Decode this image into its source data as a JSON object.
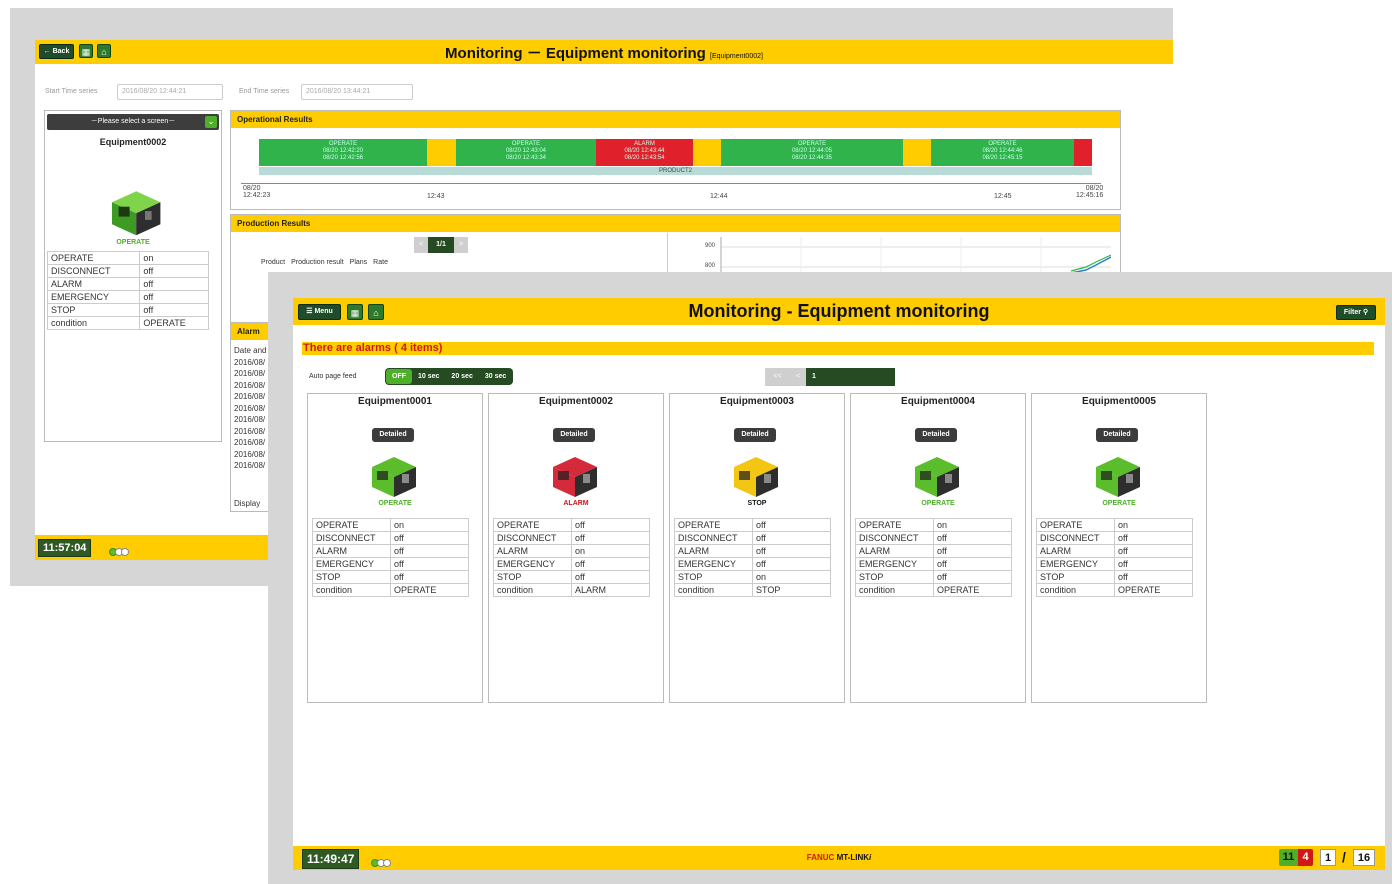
{
  "back_window": {
    "title": "Monitoring － Equipment monitoring",
    "title_tag": "[Equipment0002]",
    "back_label": "Back",
    "start_time_label": "Start Time series",
    "start_time_value": "2016/08/20 12:44:21",
    "end_time_label": "End Time series",
    "end_time_value": "2016/08/20 13:44:21",
    "screen_select": "－Please select a screen－",
    "equipment_name": "Equipment0002",
    "state_label": "OPERATE",
    "status_rows": [
      {
        "k": "OPERATE",
        "v": "on"
      },
      {
        "k": "DISCONNECT",
        "v": "off"
      },
      {
        "k": "ALARM",
        "v": "off"
      },
      {
        "k": "EMERGENCY",
        "v": "off"
      },
      {
        "k": "STOP",
        "v": "off"
      },
      {
        "k": "condition",
        "v": "OPERATE"
      }
    ],
    "operational_results": {
      "title": "Operational Results",
      "segments": [
        {
          "state": "OPERATE",
          "l1": "08/20 12:42:20",
          "l2": "08/20 12:42:56",
          "color": "#2fb34a"
        },
        {
          "state": "",
          "l1": "",
          "l2": "",
          "color": "#ffcc00"
        },
        {
          "state": "OPERATE",
          "l1": "08/20 12:43:04",
          "l2": "08/20 12:43:34",
          "color": "#2fb34a"
        },
        {
          "state": "ALARM",
          "l1": "08/20 12:43:44",
          "l2": "08/20 12:43:54",
          "color": "#e0202a"
        },
        {
          "state": "",
          "l1": "",
          "l2": "",
          "color": "#ffcc00"
        },
        {
          "state": "OPERATE",
          "l1": "08/20 12:44:05",
          "l2": "08/20 12:44:35",
          "color": "#2fb34a"
        },
        {
          "state": "",
          "l1": "",
          "l2": "",
          "color": "#ffcc00"
        },
        {
          "state": "OPERATE",
          "l1": "08/20 12:44:46",
          "l2": "08/20 12:45:15",
          "color": "#2fb34a"
        },
        {
          "state": "",
          "l1": "",
          "l2": "",
          "color": "#e0202a"
        }
      ],
      "product_band": "PRODUCT2",
      "axis_start_date": "08/20",
      "axis_start_time": "12:42:23",
      "axis_ticks": [
        "12:43",
        "12:44",
        "12:45"
      ],
      "axis_end_date": "08/20",
      "axis_end_time": "12:45:16"
    },
    "production_results": {
      "title": "Production Results",
      "pager": "1/1",
      "headers": [
        "Product",
        "Production result",
        "Plans",
        "Rate"
      ],
      "chart_y_ticks": [
        "900",
        "800"
      ]
    },
    "alarm_panel": {
      "title": "Alarm",
      "header": "Date and",
      "rows": [
        "2016/08/",
        "2016/08/",
        "2016/08/",
        "2016/08/",
        "2016/08/",
        "2016/08/",
        "2016/08/",
        "2016/08/",
        "2016/08/",
        "2016/08/"
      ],
      "footer": "Display"
    },
    "clock": "11:57:04"
  },
  "front_window": {
    "menu_label": "Menu",
    "title": "Monitoring - Equipment monitoring",
    "filter_label": "Filter",
    "alarm_banner": "There are alarms ( 4 items)",
    "auto_page_label": "Auto page feed",
    "auto_page_options": [
      "OFF",
      "10 sec",
      "20 sec",
      "30 sec"
    ],
    "pager": {
      "first": "<<",
      "prev": "<",
      "current": "1"
    },
    "equipment": [
      {
        "name": "Equipment0001",
        "detail": "Detailed",
        "state": "OPERATE",
        "state_color": "#4fae2a",
        "machine_color": "#5bbd2b",
        "rows": [
          {
            "k": "OPERATE",
            "v": "on"
          },
          {
            "k": "DISCONNECT",
            "v": "off"
          },
          {
            "k": "ALARM",
            "v": "off"
          },
          {
            "k": "EMERGENCY",
            "v": "off"
          },
          {
            "k": "STOP",
            "v": "off"
          },
          {
            "k": "condition",
            "v": "OPERATE"
          }
        ]
      },
      {
        "name": "Equipment0002",
        "detail": "Detailed",
        "state": "ALARM",
        "state_color": "#d01818",
        "machine_color": "#d52a3a",
        "rows": [
          {
            "k": "OPERATE",
            "v": "off"
          },
          {
            "k": "DISCONNECT",
            "v": "off"
          },
          {
            "k": "ALARM",
            "v": "on"
          },
          {
            "k": "EMERGENCY",
            "v": "off"
          },
          {
            "k": "STOP",
            "v": "off"
          },
          {
            "k": "condition",
            "v": "ALARM"
          }
        ]
      },
      {
        "name": "Equipment0003",
        "detail": "Detailed",
        "state": "STOP",
        "state_color": "#111111",
        "machine_color": "#f3c614",
        "rows": [
          {
            "k": "OPERATE",
            "v": "off"
          },
          {
            "k": "DISCONNECT",
            "v": "off"
          },
          {
            "k": "ALARM",
            "v": "off"
          },
          {
            "k": "EMERGENCY",
            "v": "off"
          },
          {
            "k": "STOP",
            "v": "on"
          },
          {
            "k": "condition",
            "v": "STOP"
          }
        ]
      },
      {
        "name": "Equipment0004",
        "detail": "Detailed",
        "state": "OPERATE",
        "state_color": "#4fae2a",
        "machine_color": "#5bbd2b",
        "rows": [
          {
            "k": "OPERATE",
            "v": "on"
          },
          {
            "k": "DISCONNECT",
            "v": "off"
          },
          {
            "k": "ALARM",
            "v": "off"
          },
          {
            "k": "EMERGENCY",
            "v": "off"
          },
          {
            "k": "STOP",
            "v": "off"
          },
          {
            "k": "condition",
            "v": "OPERATE"
          }
        ]
      },
      {
        "name": "Equipment0005",
        "detail": "Detailed",
        "state": "OPERATE",
        "state_color": "#4fae2a",
        "machine_color": "#5bbd2b",
        "rows": [
          {
            "k": "OPERATE",
            "v": "on"
          },
          {
            "k": "DISCONNECT",
            "v": "off"
          },
          {
            "k": "ALARM",
            "v": "off"
          },
          {
            "k": "EMERGENCY",
            "v": "off"
          },
          {
            "k": "STOP",
            "v": "off"
          },
          {
            "k": "condition",
            "v": "OPERATE"
          }
        ]
      }
    ],
    "clock": "11:49:47",
    "brand_red": "FANUC",
    "brand_black": "MT-LINK",
    "brand_suffix": "i",
    "count_green": "11",
    "count_red": "4",
    "page_current": "1",
    "page_sep": "/",
    "page_total": "16"
  }
}
